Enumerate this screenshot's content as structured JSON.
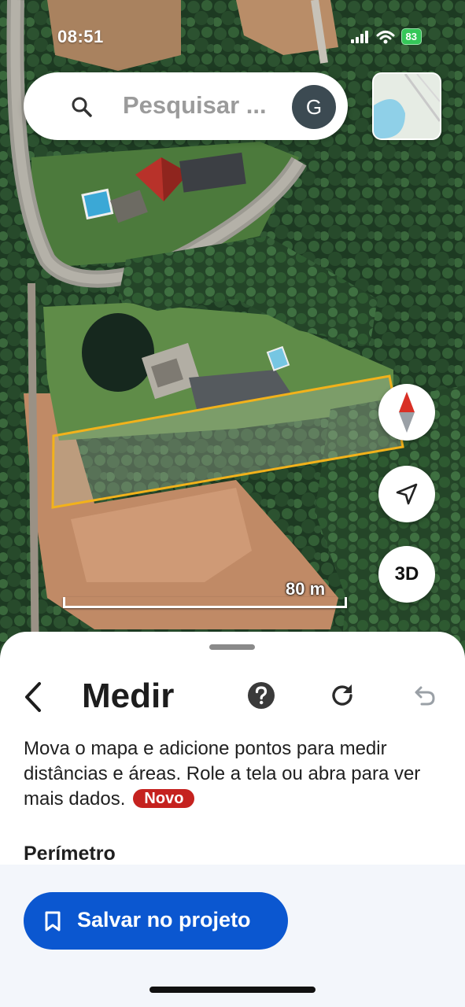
{
  "status_bar": {
    "time": "08:51",
    "battery": "83",
    "icons": [
      "signal-icon",
      "wifi-icon",
      "battery-icon"
    ]
  },
  "search": {
    "placeholder": "Pesquisar ...",
    "avatar_letter": "G"
  },
  "map": {
    "type": "satellite",
    "measured_polygon_color": "#f2b21b",
    "scale_label": "80 m",
    "buttons": {
      "compass": "compass-icon",
      "locate": "navigation-arrow-icon",
      "three_d": "3D"
    }
  },
  "sheet": {
    "title": "Medir",
    "description": "Mova o mapa e adicione pontos para medir distâncias e áreas. Role a tela ou abra para ver mais dados.",
    "badge": "Novo",
    "section_label": "Perímetro",
    "save_button": "Salvar no projeto",
    "actions": [
      "back-icon",
      "help-icon",
      "refresh-icon",
      "undo-icon"
    ]
  },
  "colors": {
    "primary_button": "#0b57d0",
    "badge": "#c5221f",
    "battery": "#35c759"
  }
}
